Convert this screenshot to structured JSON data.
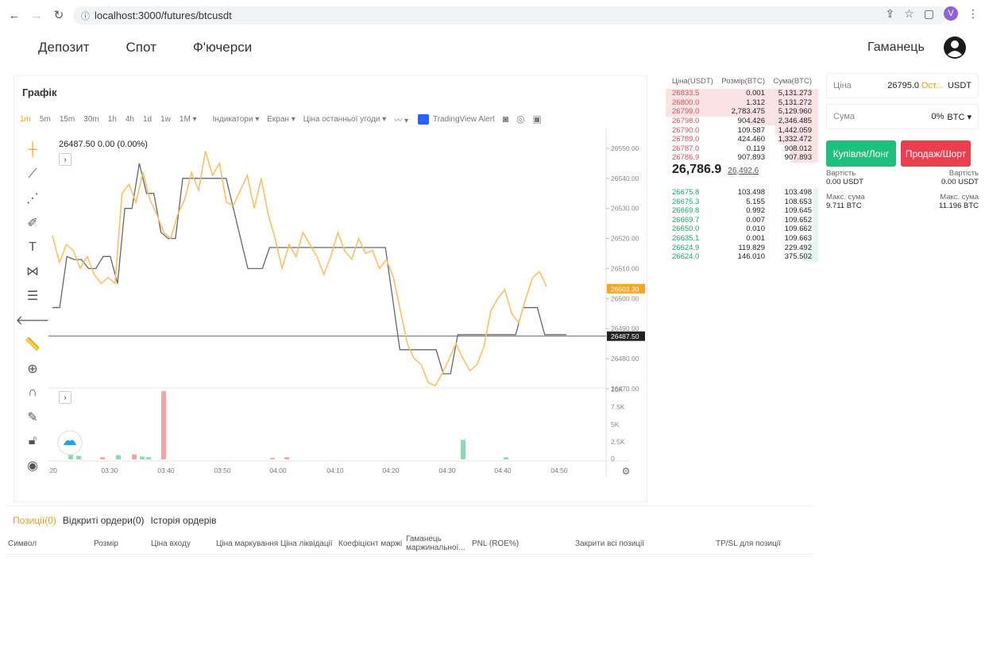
{
  "browser": {
    "url": "localhost:3000/futures/btcusdt",
    "profile_initial": "V"
  },
  "nav": {
    "items": [
      "Депозит",
      "Спот",
      "Ф'ючерси"
    ],
    "wallet": "Гаманець"
  },
  "chart": {
    "title": "Графік",
    "timeframes": [
      "1m",
      "5m",
      "15m",
      "30m",
      "1h",
      "4h",
      "1d",
      "1w",
      "1M ▾"
    ],
    "active_timeframe": "1m",
    "menus": [
      "Індикатори ▾",
      "Екран ▾",
      "Ціна останньої угоди ▾",
      "〰 ▾"
    ],
    "tv_alert": "TradingView Alert",
    "legend": "26487.50  0.00 (0.00%)",
    "price_ticks": [
      "26550.00",
      "26540.00",
      "26530.00",
      "26520.00",
      "26510.00",
      "26500.00",
      "26490.00",
      "26480.00",
      "26470.00"
    ],
    "volume_ticks": [
      "10K",
      "7.5K",
      "5K",
      "2.5K",
      "0"
    ],
    "time_ticks": [
      ":20",
      "03:30",
      "03:40",
      "03:50",
      "04:00",
      "04:10",
      "04:20",
      "04:30",
      "04:40",
      "04:50"
    ],
    "badge_orange": "26503.30",
    "badge_dark": "26487.50",
    "colors": {
      "line_yellow": "#f5c26b",
      "line_grey": "#666666",
      "badge_orange": "#f6a623",
      "vol_red": "#f3a5a5",
      "vol_green": "#8fd8b4"
    }
  },
  "orderbook": {
    "headers": [
      "Ціна(USDT)",
      "Розмір(BTC)",
      "Сума(BTC)"
    ],
    "asks": [
      [
        "26833.5",
        "0.001",
        "5,131.273"
      ],
      [
        "26800.0",
        "1.312",
        "5,131.272"
      ],
      [
        "26799.0",
        "2,783.475",
        "5,129.960"
      ],
      [
        "26798.0",
        "904.426",
        "2,346.485"
      ],
      [
        "26790.0",
        "109.587",
        "1,442.059"
      ],
      [
        "26789.0",
        "424.460",
        "1,332.472"
      ],
      [
        "26787.0",
        "0.119",
        "908.012"
      ],
      [
        "26786.9",
        "907.893",
        "907.893"
      ]
    ],
    "mid_price": "26,786.9",
    "mark_price": "26,492.6",
    "bids": [
      [
        "26675.8",
        "103.498",
        "103.498"
      ],
      [
        "26675.3",
        "5.155",
        "108.653"
      ],
      [
        "26669.8",
        "0.992",
        "109.645"
      ],
      [
        "26669.7",
        "0.007",
        "109.652"
      ],
      [
        "26650.0",
        "0.010",
        "109.662"
      ],
      [
        "26635.1",
        "0.001",
        "109.663"
      ],
      [
        "26624.9",
        "119.829",
        "229.492"
      ],
      [
        "26624.0",
        "146.010",
        "375.502"
      ]
    ]
  },
  "trade": {
    "price_label": "Ціна",
    "price_value": "26795.0",
    "price_type": "Ост...",
    "price_unit": "USDT",
    "amount_label": "Сума",
    "amount_value": "0%",
    "amount_unit": "BTC ▾",
    "buy_label": "Купівля/Лонг",
    "sell_label": "Продаж/Шорт",
    "cost_label": "Вартість",
    "cost_buy": "0.00 USDT",
    "cost_sell": "0.00 USDT",
    "max_label": "Макс. сума",
    "max_buy": "9.711 BTC",
    "max_sell": "11.196 BTC"
  },
  "positions": {
    "tabs": [
      "Позиції(0)",
      "Відкриті ордери(0)",
      "Історія ордерів"
    ],
    "columns": [
      "Символ",
      "Розмір",
      "Ціна входу",
      "Ціна маркування",
      "Ціна ліквідації",
      "Коефіцієнт маржі",
      "Гаманець маржинальної...",
      "PNL (ROE%)",
      "Закрити всі позиції",
      "TP/SL для позиції"
    ]
  }
}
